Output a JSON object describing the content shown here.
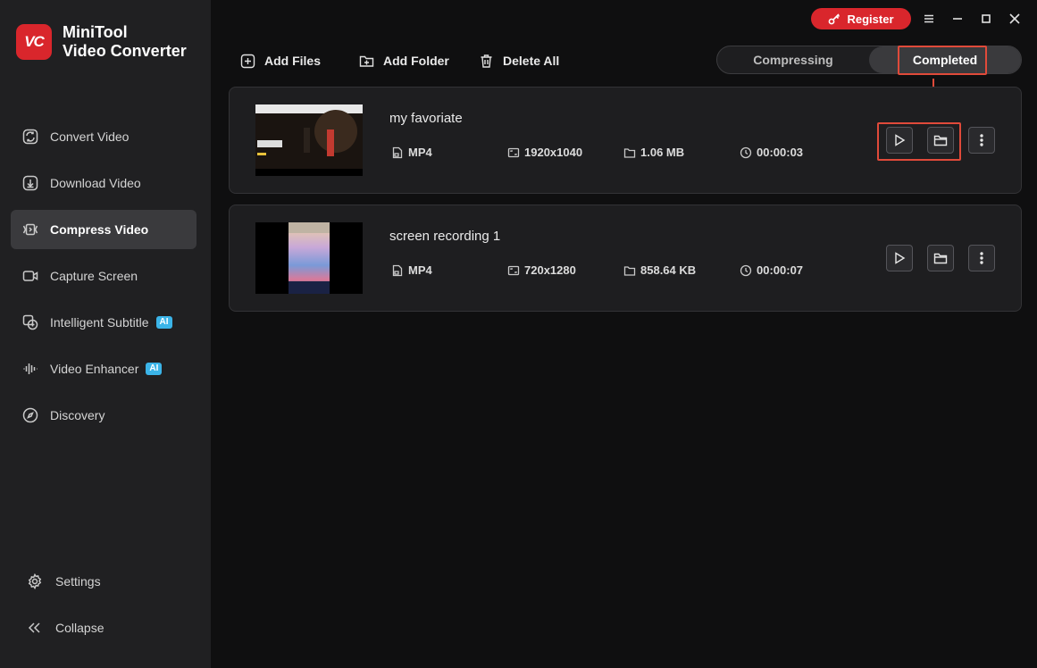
{
  "brand": {
    "logo_text": "VC",
    "line1": "MiniTool",
    "line2": "Video Converter"
  },
  "titlebar": {
    "register_label": "Register",
    "menu_icon": "hamburger-icon",
    "minimize_icon": "minimize-icon",
    "maximize_icon": "maximize-icon",
    "close_icon": "close-icon"
  },
  "sidebar": {
    "items": [
      {
        "label": "Convert Video",
        "icon": "convert-icon",
        "active": false
      },
      {
        "label": "Download Video",
        "icon": "download-icon",
        "active": false
      },
      {
        "label": "Compress Video",
        "icon": "compress-icon",
        "active": true
      },
      {
        "label": "Capture Screen",
        "icon": "camera-icon",
        "active": false
      },
      {
        "label": "Intelligent Subtitle",
        "icon": "subtitle-icon",
        "badge": "AI",
        "active": false
      },
      {
        "label": "Video Enhancer",
        "icon": "waveform-icon",
        "badge": "AI",
        "active": false
      },
      {
        "label": "Discovery",
        "icon": "compass-icon",
        "active": false
      }
    ],
    "settings_label": "Settings",
    "collapse_label": "Collapse"
  },
  "toolbar": {
    "add_files": "Add Files",
    "add_folder": "Add Folder",
    "delete_all": "Delete All"
  },
  "tabs": {
    "compressing": "Compressing",
    "completed": "Completed",
    "active": "completed"
  },
  "files": [
    {
      "name": "my favoriate",
      "format": "MP4",
      "resolution": "1920x1040",
      "size": "1.06 MB",
      "duration": "00:00:03"
    },
    {
      "name": "screen recording 1",
      "format": "MP4",
      "resolution": "720x1280",
      "size": "858.64 KB",
      "duration": "00:00:07"
    }
  ],
  "colors": {
    "accent_red": "#d9262c",
    "highlight": "#e04a3a",
    "ai_badge": "#3bb4e8",
    "sidebar_bg": "#202022",
    "main_bg": "#0f0f10"
  }
}
